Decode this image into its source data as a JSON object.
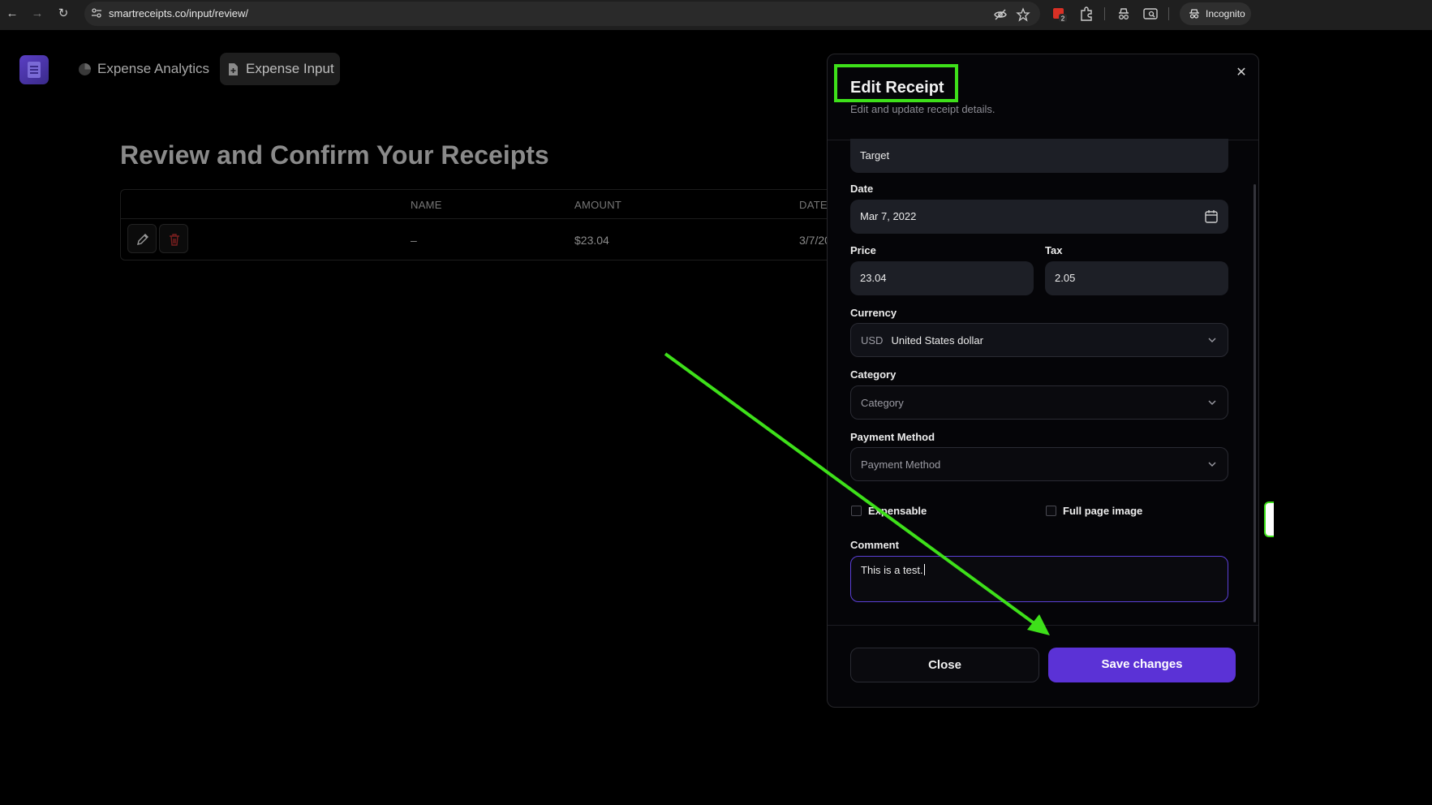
{
  "browser": {
    "url": "smartreceipts.co/input/review/",
    "incognito_label": "Incognito",
    "extension_badge": "2"
  },
  "app": {
    "nav": [
      {
        "label": "Expense Analytics",
        "icon": "pie-chart-icon",
        "active": false
      },
      {
        "label": "Expense Input",
        "icon": "file-plus-icon",
        "active": true
      }
    ]
  },
  "page": {
    "title": "Review and Confirm Your Receipts",
    "table": {
      "headers": [
        "NAME",
        "AMOUNT",
        "DATE"
      ],
      "rows": [
        {
          "name": "–",
          "amount": "$23.04",
          "date": "3/7/20"
        }
      ]
    }
  },
  "modal": {
    "title": "Edit Receipt",
    "description": "Edit and update receipt details.",
    "merchant_value": "Target",
    "date": {
      "label": "Date",
      "value": "Mar 7, 2022"
    },
    "price": {
      "label": "Price",
      "value": "23.04"
    },
    "tax": {
      "label": "Tax",
      "value": "2.05"
    },
    "currency": {
      "label": "Currency",
      "code": "USD",
      "name": "United States dollar"
    },
    "category": {
      "label": "Category",
      "placeholder": "Category"
    },
    "payment_method": {
      "label": "Payment Method",
      "placeholder": "Payment Method"
    },
    "expensable": {
      "label": "Expensable",
      "checked": false
    },
    "full_page_image": {
      "label": "Full page image",
      "checked": false
    },
    "comment": {
      "label": "Comment",
      "value": "This is a test."
    },
    "close_label": "Close",
    "save_label": "Save changes"
  },
  "colors": {
    "accent": "#5b32d6",
    "annotation": "#3ee01a",
    "background": "#000000"
  }
}
